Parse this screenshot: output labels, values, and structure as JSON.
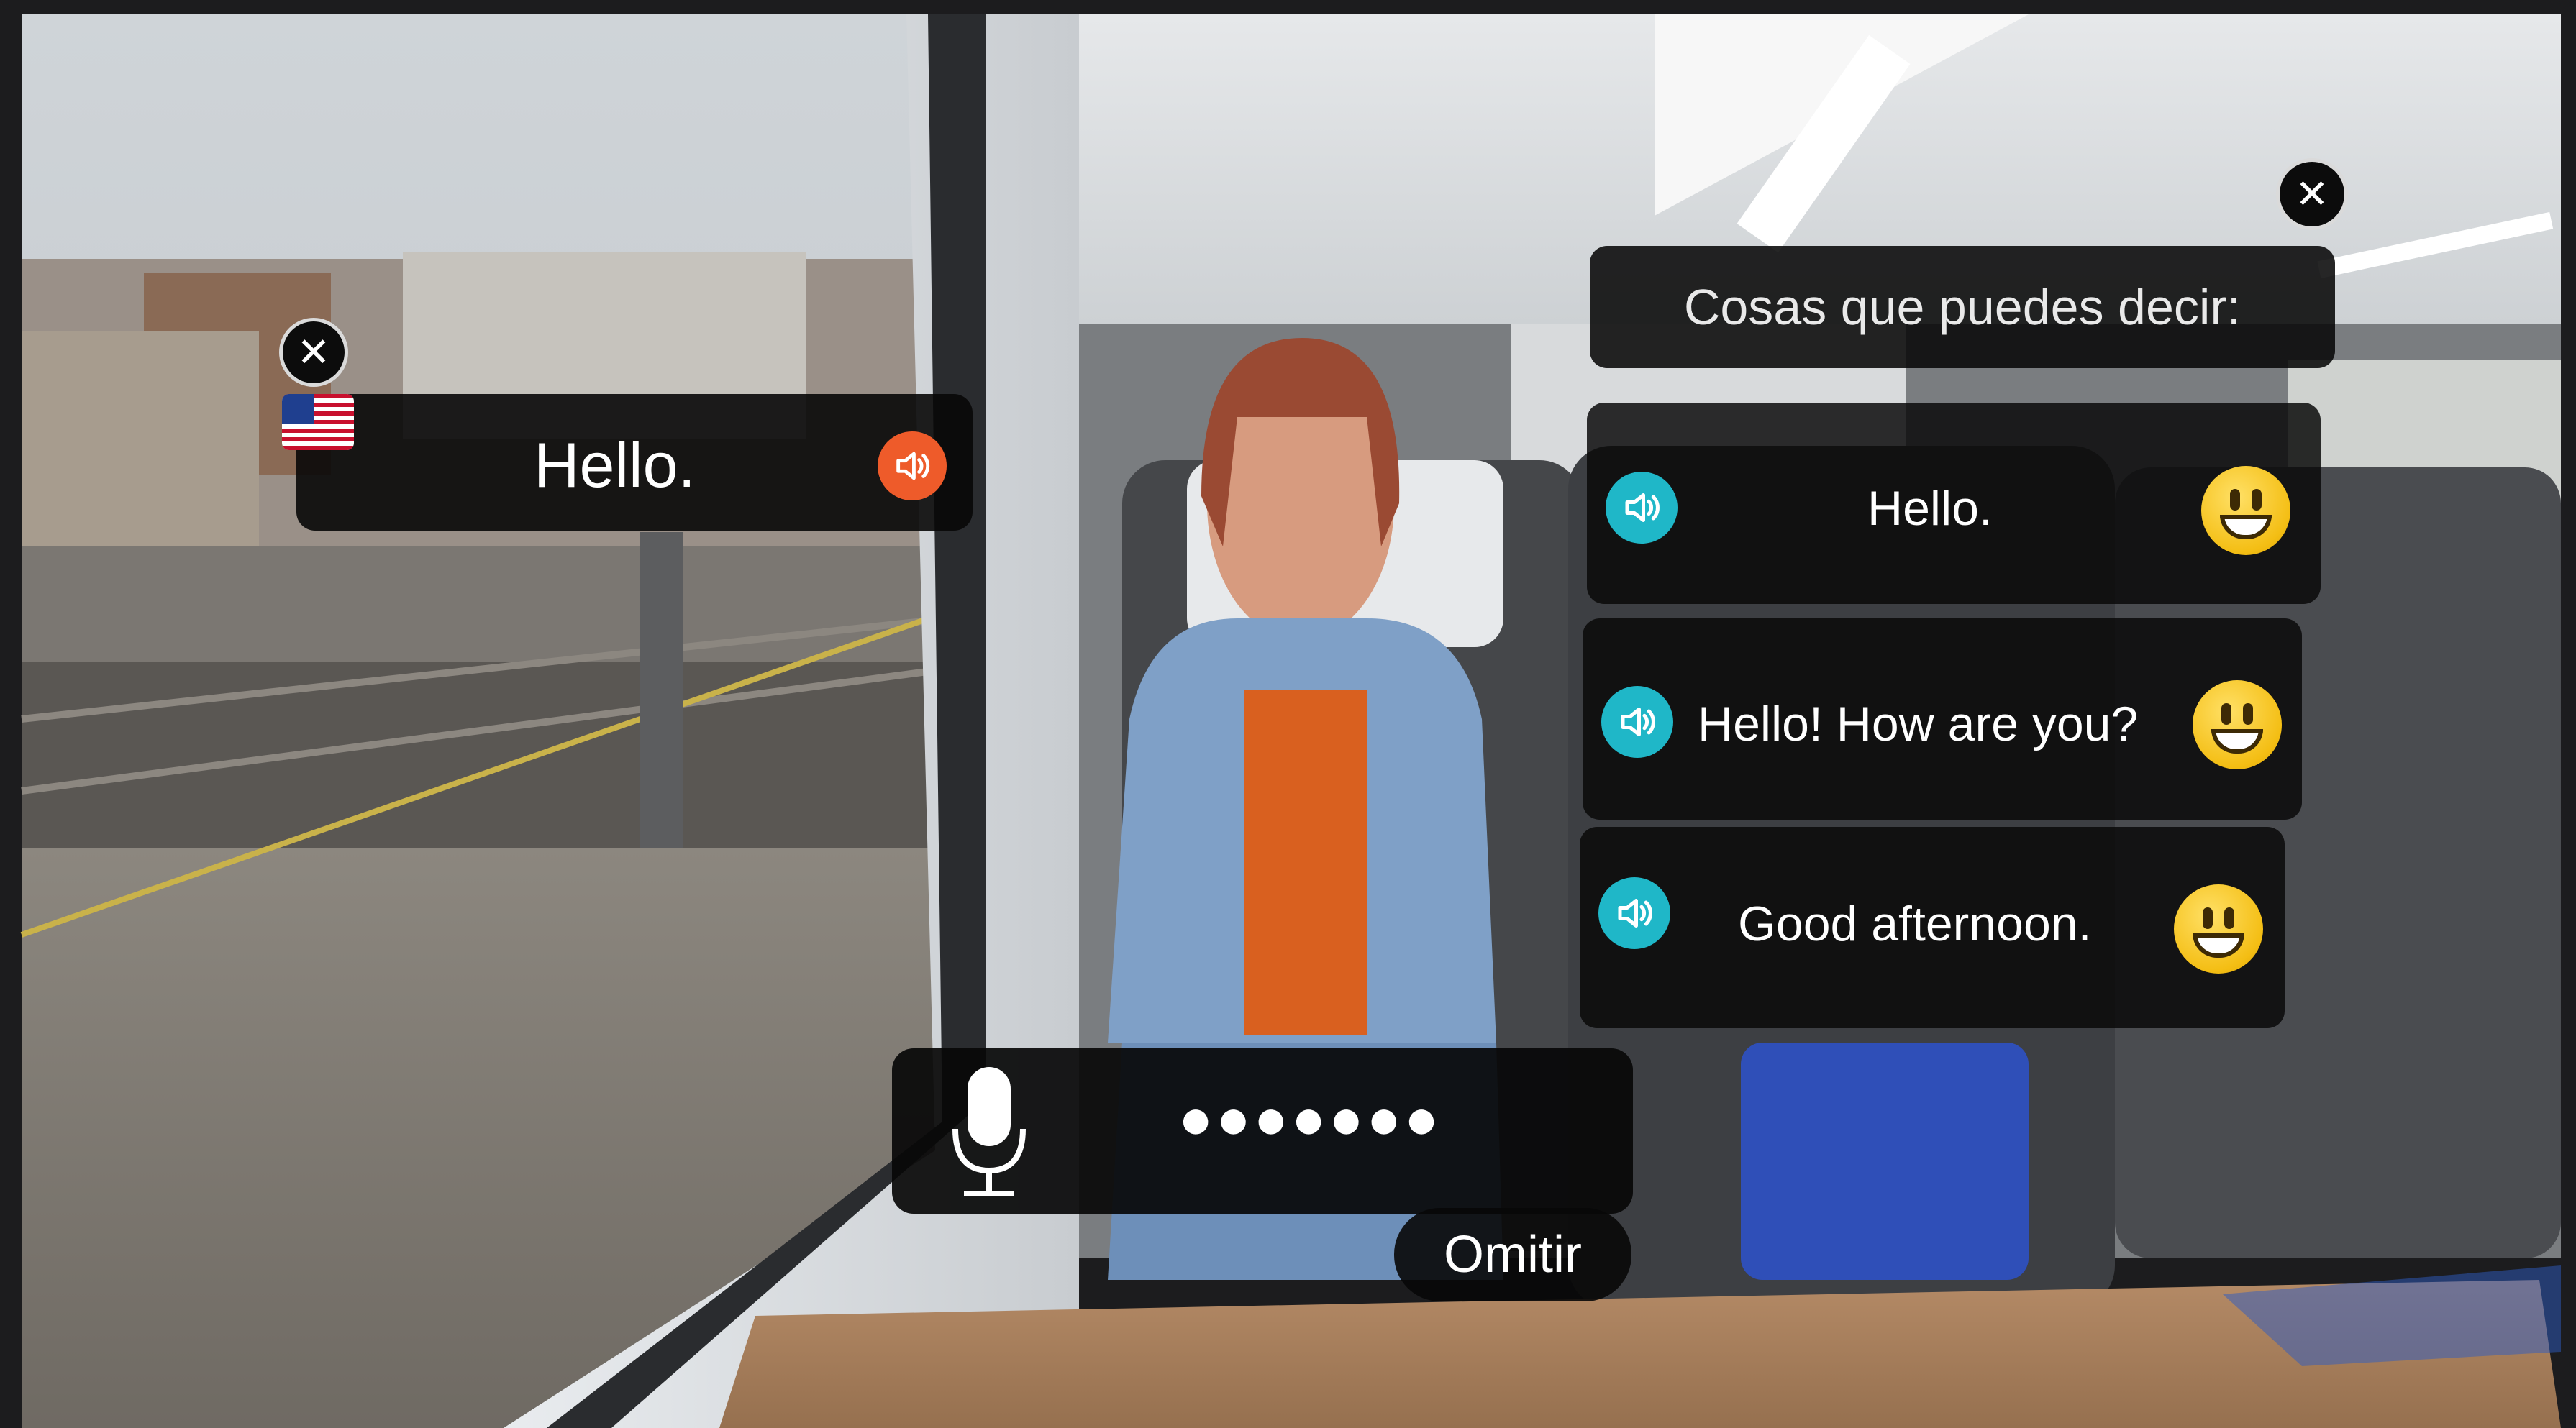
{
  "translation_card": {
    "text": "Hello.",
    "flag_icon": "us-flag-icon",
    "audio_icon": "speaker-icon",
    "audio_color": "#EE5B2A"
  },
  "suggestions": {
    "header": "Cosas que puedes decir:",
    "items": [
      {
        "text": "Hello.",
        "audio_icon": "speaker-icon",
        "emoji_icon": "grinning-face-icon"
      },
      {
        "text": "Hello! How are you?",
        "audio_icon": "speaker-icon",
        "emoji_icon": "grinning-face-icon"
      },
      {
        "text": "Good afternoon.",
        "audio_icon": "speaker-icon",
        "emoji_icon": "grinning-face-icon"
      }
    ],
    "audio_color": "#1FB7C8",
    "emoji_color": "#F4BE14"
  },
  "voice_input": {
    "mic_icon": "microphone-icon",
    "masked_text": "●●●●●●●",
    "skip_label": "Omitir"
  },
  "close_icon": "close-icon"
}
